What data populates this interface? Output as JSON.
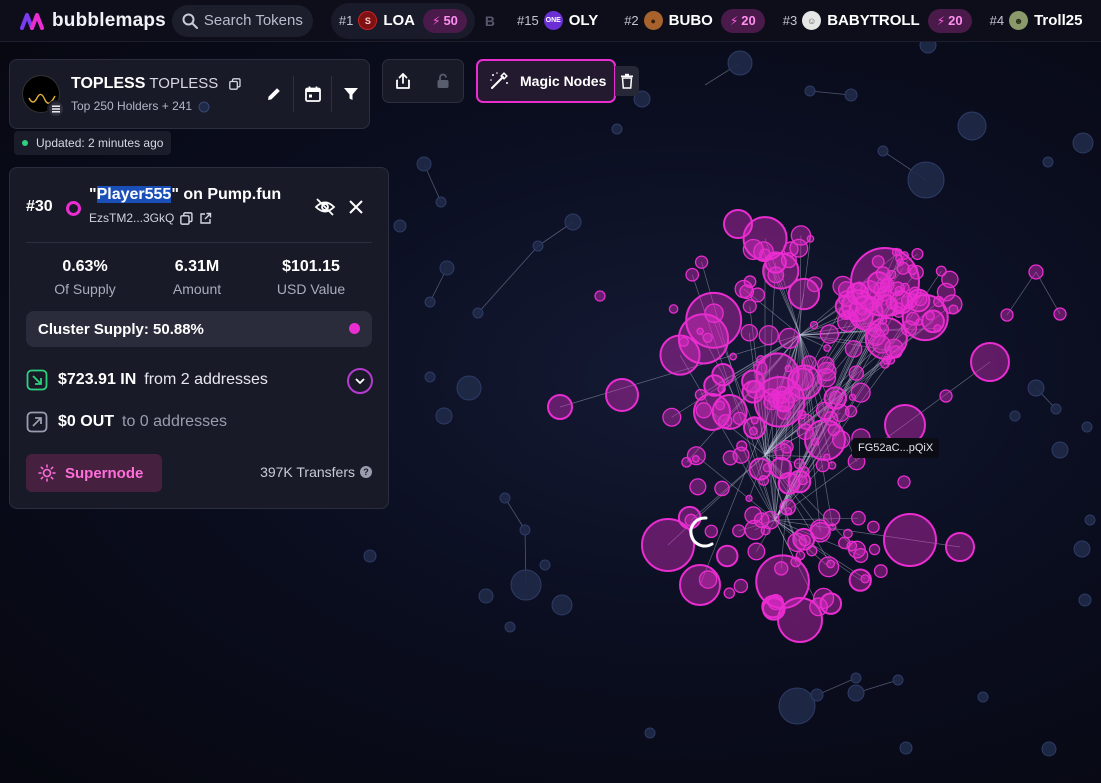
{
  "brand": {
    "name": "bubblemaps"
  },
  "search": {
    "placeholder": "Search Tokens"
  },
  "tickers": [
    {
      "rank": "#1",
      "symbol": "LOA",
      "boost": "50",
      "icon": "S",
      "color": "#8a1616"
    },
    {
      "rank": "#15",
      "symbol": "OLY",
      "boost": "",
      "icon": "ONE",
      "color": "#6b2fd6"
    },
    {
      "rank": "#2",
      "symbol": "BUBO",
      "boost": "20",
      "icon": "",
      "color": "#a8622c"
    },
    {
      "rank": "#3",
      "symbol": "BABYTROLL",
      "boost": "20",
      "icon": "",
      "color": "#d9d9d9"
    },
    {
      "rank": "#4",
      "symbol": "Troll25",
      "boost": "",
      "icon": "",
      "color": "#8a9a6a"
    }
  ],
  "ticker_faded": "B",
  "token": {
    "name": "TOPLESS",
    "symbol": "TOPLESS",
    "holders": "Top 250 Holders + 241",
    "updated": "Updated: 2 minutes ago"
  },
  "magic": {
    "label": "Magic Nodes"
  },
  "holder": {
    "rank": "#30",
    "name_prefix": "\"",
    "name_highlight": "Player555",
    "name_suffix": "\" on Pump.fun",
    "address": "EzsTM2...3GkQ",
    "stats": [
      {
        "value": "0.63%",
        "label": "Of Supply"
      },
      {
        "value": "6.31M",
        "label": "Amount"
      },
      {
        "value": "$101.15",
        "label": "USD Value"
      }
    ],
    "cluster_supply": "Cluster Supply: 50.88%",
    "in_amount": "$723.91 IN",
    "in_text": "from 2 addresses",
    "out_amount": "$0 OUT",
    "out_text": "to 0 addresses",
    "supernode_label": "Supernode",
    "transfers": "397K Transfers",
    "help": "?"
  },
  "graph": {
    "tooltip": "FG52aC...pQiX",
    "accent": "#e92dd0",
    "dim_node": "#1f2a48"
  }
}
